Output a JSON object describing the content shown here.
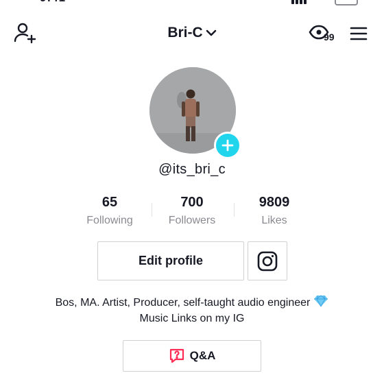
{
  "header": {
    "username": "Bri-C",
    "views_count": "99"
  },
  "profile": {
    "handle": "@its_bri_c",
    "stats": [
      {
        "value": "65",
        "label": "Following"
      },
      {
        "value": "700",
        "label": "Followers"
      },
      {
        "value": "9809",
        "label": "Likes"
      }
    ],
    "edit_profile_label": "Edit profile",
    "bio": {
      "line1": "Bos, MA. Artist, Producer, self-taught audio engineer",
      "line2": "Music Links on my IG"
    },
    "qa_label": "Q&A"
  },
  "colors": {
    "accent_add": "#20d5ec",
    "qa_icon": "#fe2c55",
    "text_primary": "#161823",
    "text_secondary": "#8a8b91"
  },
  "icons": [
    "add-friend-icon",
    "chevron-down-icon",
    "eye-icon",
    "menu-icon",
    "plus-icon",
    "instagram-icon",
    "diamond-icon",
    "qa-icon"
  ]
}
